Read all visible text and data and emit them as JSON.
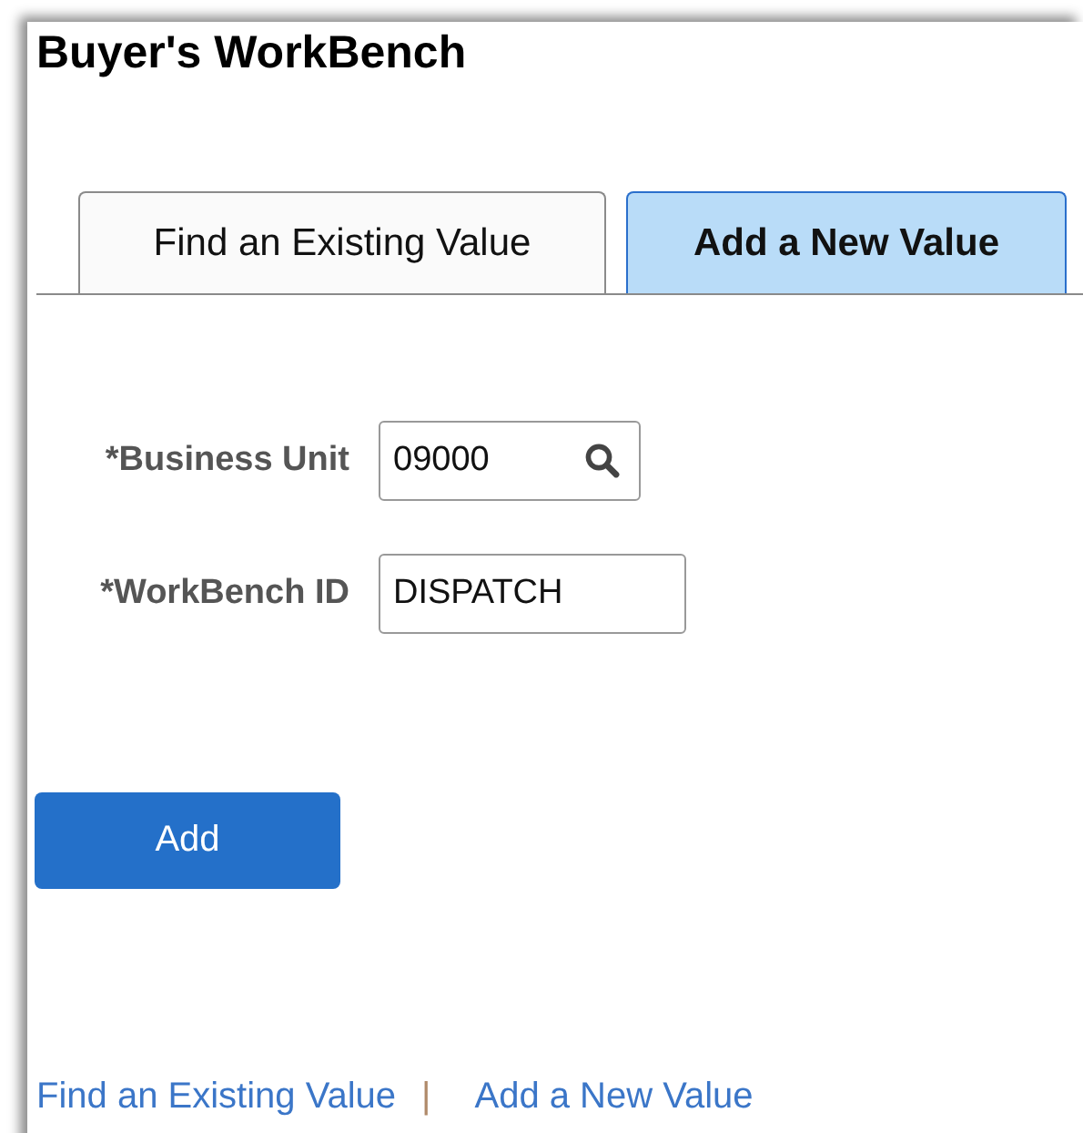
{
  "page_title": "Buyer's WorkBench",
  "tabs": [
    {
      "label": "Find an Existing Value",
      "selected": false
    },
    {
      "label": "Add a New Value",
      "selected": true
    }
  ],
  "fields": [
    {
      "label": "*Business Unit",
      "value": "09000",
      "kind": "lookup"
    },
    {
      "label": "*WorkBench ID",
      "value": "DISPATCH",
      "kind": "text"
    }
  ],
  "add_button": "Add",
  "footer_links": [
    {
      "label": "Find an Existing Value"
    },
    {
      "label": "Add a New Value"
    }
  ],
  "footer_separator": "|"
}
